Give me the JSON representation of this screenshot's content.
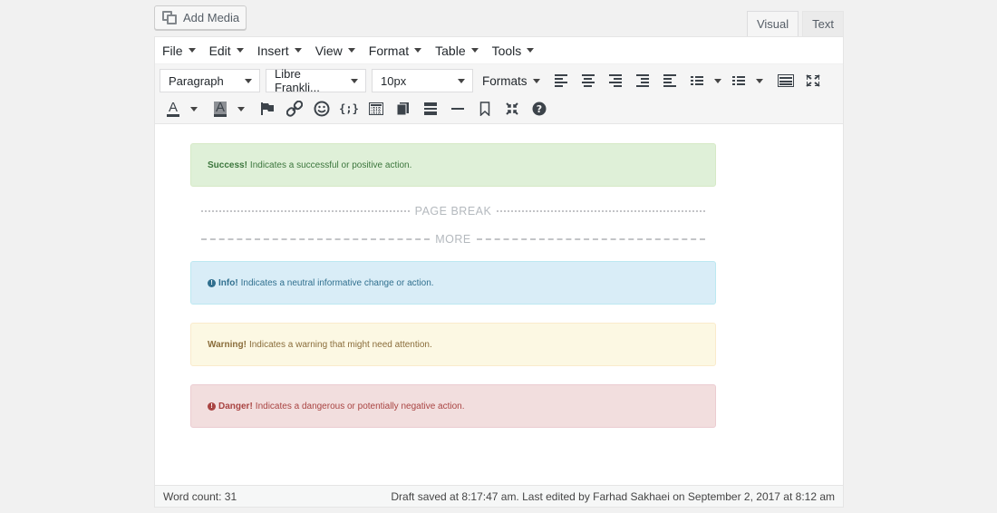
{
  "add_media": {
    "label": "Add Media",
    "icon": "media-icon"
  },
  "tabs": {
    "visual": "Visual",
    "text": "Text"
  },
  "menubar": [
    "File",
    "Edit",
    "Insert",
    "View",
    "Format",
    "Table",
    "Tools"
  ],
  "toolbar": {
    "block_format": "Paragraph",
    "font_family": "Libre Frankli...",
    "font_size": "10px",
    "formats": "Formats",
    "text_color_glyph": "A",
    "bg_color_glyph": "A",
    "code_glyph": "{;}"
  },
  "content": {
    "success": {
      "title": "Success!",
      "text": "Indicates a successful or positive action."
    },
    "page_break": "PAGE BREAK",
    "more": "MORE",
    "info": {
      "title": "Info!",
      "text": "Indicates a neutral informative change or action."
    },
    "warning": {
      "title": "Warning!",
      "text": "Indicates a warning that might need attention."
    },
    "danger": {
      "title": "Danger!",
      "text": "Indicates a dangerous or potentially negative action."
    }
  },
  "status": {
    "word_count": "Word count: 31",
    "draft_saved": "Draft saved at 8:17:47 am. Last edited by Farhad Sakhaei on September 2, 2017 at 8:12 am"
  },
  "colors": {
    "success_bg": "#dff0d8",
    "success_text": "#3c763d",
    "info_bg": "#d9edf7",
    "info_text": "#31708f",
    "warning_bg": "#fcf8e3",
    "warning_text": "#8a6d3b",
    "danger_bg": "#f2dede",
    "danger_text": "#a94442"
  }
}
